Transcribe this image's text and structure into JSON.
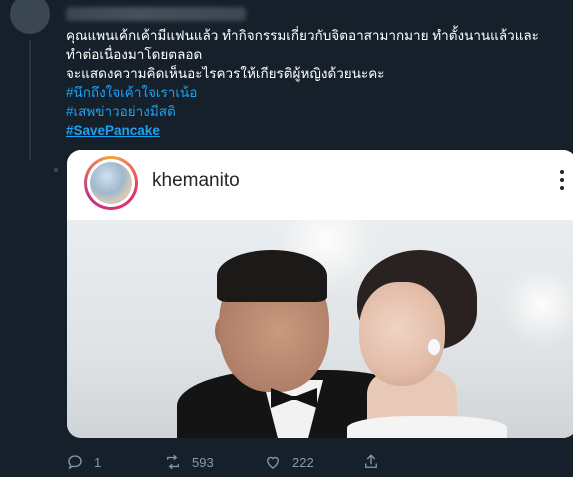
{
  "tweet": {
    "lines": [
      "คุณแพนเค้กเค้ามีแฟนแล้ว ทำกิจกรรมเกี่ยวกับจิตอาสามากมาย ทำตั้งนานแล้วและ",
      "ทำต่อเนื่องมาโดยตลอด",
      "จะแสดงความคิดเห็นอะไรควรให้เกียรติผู้หญิงด้วยนะคะ"
    ],
    "hashtags": [
      "#นึกถึงใจเค้าใจเราเน้อ",
      "#เสพข่าวอย่างมีสติ",
      "#SavePancake"
    ]
  },
  "card": {
    "username": "khemanito",
    "icon": "more-vertical-icon"
  },
  "actions": {
    "reply_count": "1",
    "retweet_count": "593",
    "like_count": "222"
  },
  "colors": {
    "background": "#15202b",
    "accent": "#1da1f2",
    "muted": "#8899a6"
  }
}
